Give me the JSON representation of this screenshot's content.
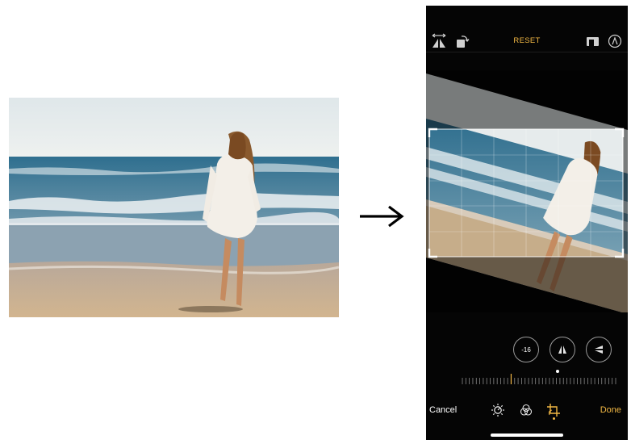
{
  "toolbar": {
    "reset_label": "RESET",
    "left_icons": [
      "flip-horizontal-icon",
      "rotate-icon"
    ],
    "right_icons": [
      "aspect-ratio-icon",
      "auto-icon"
    ]
  },
  "adjust": {
    "straighten_value": "-16",
    "dials": [
      "straighten-dial",
      "vertical-perspective-dial",
      "horizontal-perspective-dial"
    ],
    "slider_level": -16
  },
  "bottom_bar": {
    "cancel_label": "Cancel",
    "done_label": "Done",
    "modes": [
      "adjust-icon",
      "filters-icon",
      "crop-icon"
    ],
    "active_mode": "crop-icon"
  },
  "colors": {
    "accent": "#f2b844",
    "background": "#050505",
    "text": "#ffffff"
  }
}
